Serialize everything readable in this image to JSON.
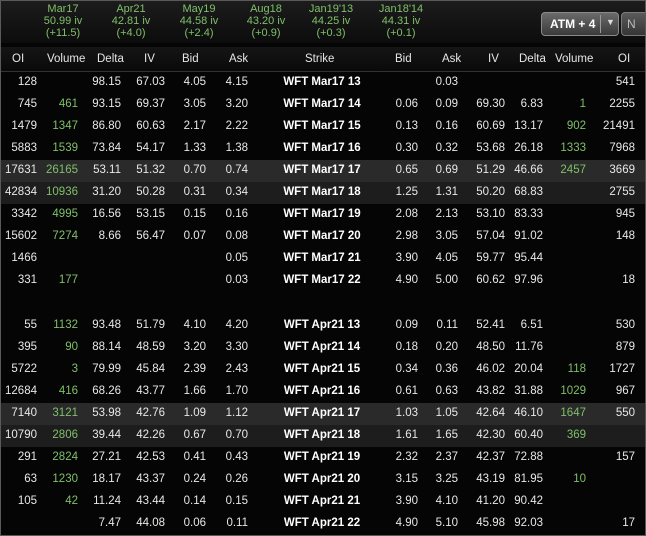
{
  "expirations": [
    {
      "month": "Mar17",
      "iv": "50.99 iv",
      "chg": "(+11.5)"
    },
    {
      "month": "Apr21",
      "iv": "42.81 iv",
      "chg": "(+4.0)"
    },
    {
      "month": "May19",
      "iv": "44.58 iv",
      "chg": "(+2.4)"
    },
    {
      "month": "Aug18",
      "iv": "43.20 iv",
      "chg": "(+0.9)"
    },
    {
      "month": "Jan19'13",
      "iv": "44.25 iv",
      "chg": "(+0.3)"
    },
    {
      "month": "Jan18'14",
      "iv": "44.31 iv",
      "chg": "(+0.1)"
    }
  ],
  "controls": {
    "atm_label": "ATM + 4",
    "next_label": "N"
  },
  "headers": {
    "oi_call": "OI",
    "volume_call": "Volume",
    "delta_call": "Delta",
    "iv_call": "IV",
    "bid_call": "Bid",
    "ask_call": "Ask",
    "strike": "Strike",
    "bid_put": "Bid",
    "ask_put": "Ask",
    "iv_put": "IV",
    "delta_put": "Delta",
    "volume_put": "Volume",
    "oi_put": "OI"
  },
  "rows": [
    {
      "c_oi": "128",
      "c_vol": "",
      "c_delta": "98.15",
      "c_iv": "67.03",
      "c_bid": "4.05",
      "c_ask": "4.15",
      "strike": "WFT Mar17 13",
      "p_bid": "",
      "p_ask": "0.03",
      "p_iv": "",
      "p_delta": "",
      "p_vol": "",
      "p_oi": "541"
    },
    {
      "c_oi": "745",
      "c_vol": "461",
      "c_delta": "93.15",
      "c_iv": "69.37",
      "c_bid": "3.05",
      "c_ask": "3.20",
      "strike": "WFT Mar17 14",
      "p_bid": "0.06",
      "p_ask": "0.09",
      "p_iv": "69.30",
      "p_delta": "6.83",
      "p_vol": "1",
      "p_oi": "2255"
    },
    {
      "c_oi": "1479",
      "c_vol": "1347",
      "c_delta": "86.80",
      "c_iv": "60.63",
      "c_bid": "2.17",
      "c_ask": "2.22",
      "strike": "WFT Mar17 15",
      "p_bid": "0.13",
      "p_ask": "0.16",
      "p_iv": "60.69",
      "p_delta": "13.17",
      "p_vol": "902",
      "p_oi": "21491"
    },
    {
      "c_oi": "5883",
      "c_vol": "1539",
      "c_delta": "73.84",
      "c_iv": "54.17",
      "c_bid": "1.33",
      "c_ask": "1.38",
      "strike": "WFT Mar17 16",
      "p_bid": "0.30",
      "p_ask": "0.32",
      "p_iv": "53.68",
      "p_delta": "26.18",
      "p_vol": "1333",
      "p_oi": "7968"
    },
    {
      "c_oi": "17631",
      "c_vol": "26165",
      "c_delta": "53.11",
      "c_iv": "51.32",
      "c_bid": "0.70",
      "c_ask": "0.74",
      "strike": "WFT Mar17 17",
      "p_bid": "0.65",
      "p_ask": "0.69",
      "p_iv": "51.29",
      "p_delta": "46.66",
      "p_vol": "2457",
      "p_oi": "3669"
    },
    {
      "c_oi": "42834",
      "c_vol": "10936",
      "c_delta": "31.20",
      "c_iv": "50.28",
      "c_bid": "0.31",
      "c_ask": "0.34",
      "strike": "WFT Mar17 18",
      "p_bid": "1.25",
      "p_ask": "1.31",
      "p_iv": "50.20",
      "p_delta": "68.83",
      "p_vol": "",
      "p_oi": "2755"
    },
    {
      "c_oi": "3342",
      "c_vol": "4995",
      "c_delta": "16.56",
      "c_iv": "53.15",
      "c_bid": "0.15",
      "c_ask": "0.16",
      "strike": "WFT Mar17 19",
      "p_bid": "2.08",
      "p_ask": "2.13",
      "p_iv": "53.10",
      "p_delta": "83.33",
      "p_vol": "",
      "p_oi": "945"
    },
    {
      "c_oi": "15602",
      "c_vol": "7274",
      "c_delta": "8.66",
      "c_iv": "56.47",
      "c_bid": "0.07",
      "c_ask": "0.08",
      "strike": "WFT Mar17 20",
      "p_bid": "2.98",
      "p_ask": "3.05",
      "p_iv": "57.04",
      "p_delta": "91.02",
      "p_vol": "",
      "p_oi": "148"
    },
    {
      "c_oi": "1466",
      "c_vol": "",
      "c_delta": "",
      "c_iv": "",
      "c_bid": "",
      "c_ask": "0.05",
      "strike": "WFT Mar17 21",
      "p_bid": "3.90",
      "p_ask": "4.05",
      "p_iv": "59.77",
      "p_delta": "95.44",
      "p_vol": "",
      "p_oi": ""
    },
    {
      "c_oi": "331",
      "c_vol": "177",
      "c_delta": "",
      "c_iv": "",
      "c_bid": "",
      "c_ask": "0.03",
      "strike": "WFT Mar17 22",
      "p_bid": "4.90",
      "p_ask": "5.00",
      "p_iv": "60.62",
      "p_delta": "97.96",
      "p_vol": "",
      "p_oi": "18"
    },
    {
      "c_oi": "55",
      "c_vol": "1132",
      "c_delta": "93.48",
      "c_iv": "51.79",
      "c_bid": "4.10",
      "c_ask": "4.20",
      "strike": "WFT Apr21 13",
      "p_bid": "0.09",
      "p_ask": "0.11",
      "p_iv": "52.41",
      "p_delta": "6.51",
      "p_vol": "",
      "p_oi": "530"
    },
    {
      "c_oi": "395",
      "c_vol": "90",
      "c_delta": "88.14",
      "c_iv": "48.59",
      "c_bid": "3.20",
      "c_ask": "3.30",
      "strike": "WFT Apr21 14",
      "p_bid": "0.18",
      "p_ask": "0.20",
      "p_iv": "48.50",
      "p_delta": "11.76",
      "p_vol": "",
      "p_oi": "879"
    },
    {
      "c_oi": "5722",
      "c_vol": "3",
      "c_delta": "79.99",
      "c_iv": "45.84",
      "c_bid": "2.39",
      "c_ask": "2.43",
      "strike": "WFT Apr21 15",
      "p_bid": "0.34",
      "p_ask": "0.36",
      "p_iv": "46.02",
      "p_delta": "20.04",
      "p_vol": "118",
      "p_oi": "1727"
    },
    {
      "c_oi": "12684",
      "c_vol": "416",
      "c_delta": "68.26",
      "c_iv": "43.77",
      "c_bid": "1.66",
      "c_ask": "1.70",
      "strike": "WFT Apr21 16",
      "p_bid": "0.61",
      "p_ask": "0.63",
      "p_iv": "43.82",
      "p_delta": "31.88",
      "p_vol": "1029",
      "p_oi": "967"
    },
    {
      "c_oi": "7140",
      "c_vol": "3121",
      "c_delta": "53.98",
      "c_iv": "42.76",
      "c_bid": "1.09",
      "c_ask": "1.12",
      "strike": "WFT Apr21 17",
      "p_bid": "1.03",
      "p_ask": "1.05",
      "p_iv": "42.64",
      "p_delta": "46.10",
      "p_vol": "1647",
      "p_oi": "550"
    },
    {
      "c_oi": "10790",
      "c_vol": "2806",
      "c_delta": "39.44",
      "c_iv": "42.26",
      "c_bid": "0.67",
      "c_ask": "0.70",
      "strike": "WFT Apr21 18",
      "p_bid": "1.61",
      "p_ask": "1.65",
      "p_iv": "42.30",
      "p_delta": "60.40",
      "p_vol": "369",
      "p_oi": ""
    },
    {
      "c_oi": "291",
      "c_vol": "2824",
      "c_delta": "27.21",
      "c_iv": "42.53",
      "c_bid": "0.41",
      "c_ask": "0.43",
      "strike": "WFT Apr21 19",
      "p_bid": "2.32",
      "p_ask": "2.37",
      "p_iv": "42.37",
      "p_delta": "72.88",
      "p_vol": "",
      "p_oi": "157"
    },
    {
      "c_oi": "63",
      "c_vol": "1230",
      "c_delta": "18.17",
      "c_iv": "43.37",
      "c_bid": "0.24",
      "c_ask": "0.26",
      "strike": "WFT Apr21 20",
      "p_bid": "3.15",
      "p_ask": "3.25",
      "p_iv": "43.19",
      "p_delta": "81.95",
      "p_vol": "10",
      "p_oi": ""
    },
    {
      "c_oi": "105",
      "c_vol": "42",
      "c_delta": "11.24",
      "c_iv": "43.44",
      "c_bid": "0.14",
      "c_ask": "0.15",
      "strike": "WFT Apr21 21",
      "p_bid": "3.90",
      "p_ask": "4.10",
      "p_iv": "41.20",
      "p_delta": "90.42",
      "p_vol": "",
      "p_oi": ""
    },
    {
      "c_oi": "",
      "c_vol": "",
      "c_delta": "7.47",
      "c_iv": "44.08",
      "c_bid": "0.06",
      "c_ask": "0.11",
      "strike": "WFT Apr21 22",
      "p_bid": "4.90",
      "p_ask": "5.10",
      "p_iv": "45.98",
      "p_delta": "92.03",
      "p_vol": "",
      "p_oi": "17"
    }
  ]
}
